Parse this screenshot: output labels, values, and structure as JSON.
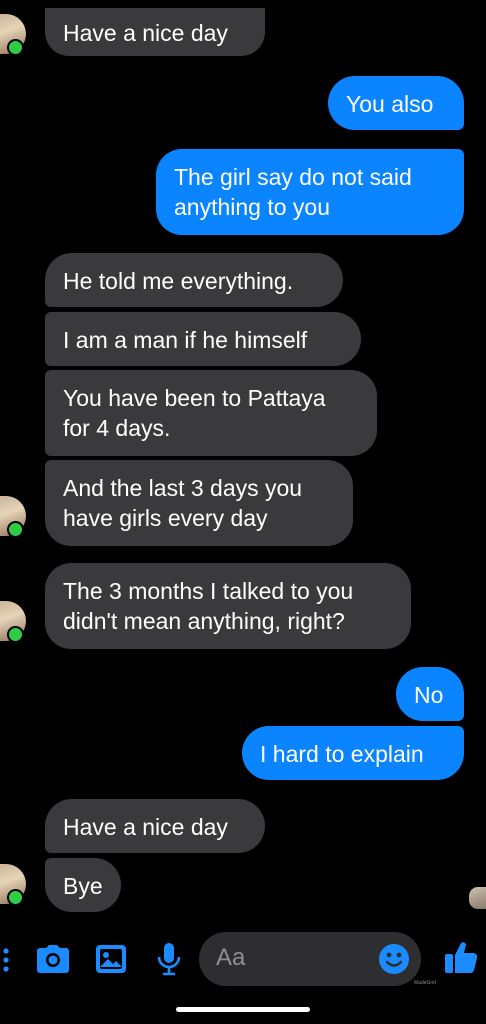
{
  "conversation": {
    "messages": [
      {
        "sender": "them",
        "text": "Have a nice day"
      },
      {
        "sender": "me",
        "text": "You also"
      },
      {
        "sender": "me",
        "text": "The girl say do not said\nanything to you"
      },
      {
        "sender": "them",
        "text": "He told me everything."
      },
      {
        "sender": "them",
        "text": "I am a man if he himself"
      },
      {
        "sender": "them",
        "text": "You have been to Pattaya\nfor 4 days."
      },
      {
        "sender": "them",
        "text": "And the last 3 days you\nhave girls every day"
      },
      {
        "sender": "them",
        "text": "The 3 months I talked to you\ndidn't mean anything, right?"
      },
      {
        "sender": "me",
        "text": "No"
      },
      {
        "sender": "me",
        "text": "I hard to explain"
      },
      {
        "sender": "them",
        "text": "Have a nice day"
      },
      {
        "sender": "them",
        "text": "Bye"
      }
    ]
  },
  "composer": {
    "placeholder": "Aa",
    "icons": [
      "more-icon",
      "camera-icon",
      "gallery-icon",
      "microphone-icon",
      "emoji-icon",
      "like-thumb-icon"
    ]
  },
  "watermark": "MadeGrid",
  "colors": {
    "background": "#000000",
    "incoming_bubble": "#3a3a3c",
    "outgoing_bubble": "#0a84ff",
    "accent": "#0a84ff",
    "online_dot": "#31cc46"
  }
}
